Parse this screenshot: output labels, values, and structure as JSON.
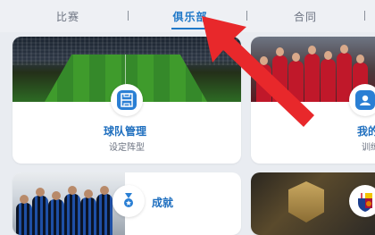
{
  "tabs": [
    {
      "label": "比赛"
    },
    {
      "label": "俱乐部"
    },
    {
      "label": "合同"
    }
  ],
  "cards": {
    "team_management": {
      "title": "球队管理",
      "subtitle": "设定阵型"
    },
    "my_team": {
      "title": "我的球",
      "subtitle": "训练"
    },
    "achievements": {
      "title": "成就"
    }
  },
  "colors": {
    "accent": "#1f78c8",
    "arrow": "#e8282b",
    "background": "#e9ecf1"
  },
  "icons": {
    "team_management": "pitch-icon",
    "my_team": "id-card-icon",
    "achievements": "medal-icon",
    "club": "fc-barcelona-crest"
  }
}
